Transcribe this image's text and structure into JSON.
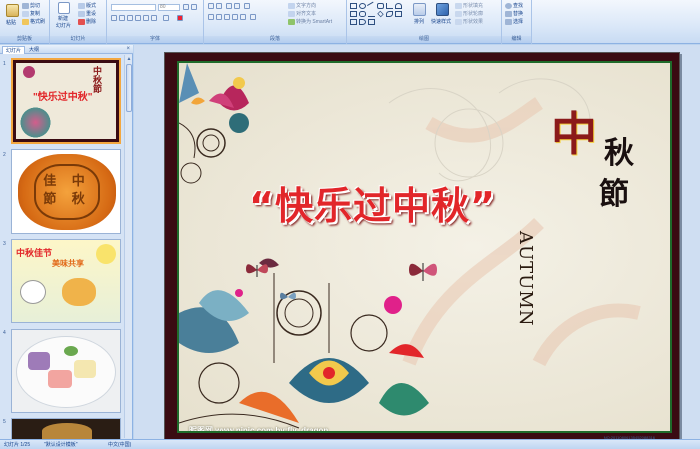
{
  "ribbon": {
    "groups": {
      "clipboard": "剪贴板",
      "slides": "幻灯片",
      "font": "字体",
      "paragraph": "段落",
      "drawing": "绘图",
      "editing": "编辑"
    },
    "clipboard": {
      "paste": "粘贴",
      "cut": "剪切",
      "copy": "复制",
      "format_painter": "格式刷"
    },
    "slides": {
      "new_slide": "新建",
      "new_slide2": "幻灯片",
      "layout": "版式",
      "reset": "重设",
      "delete": "删除"
    },
    "font": {
      "font_name": "",
      "font_size": "80"
    },
    "paragraph": {
      "text_direction": "文字方向",
      "align_text": "对齐文本",
      "smartart": "转换为 SmartArt"
    },
    "drawing": {
      "arrange": "排列",
      "quick_styles": "快速样式",
      "shape_fill": "形状填充",
      "shape_outline": "形状轮廓",
      "shape_effects": "形状效果"
    },
    "editing": {
      "find": "查找",
      "replace": "替换",
      "select": "选择"
    }
  },
  "pane": {
    "tab_slides": "幻灯片",
    "tab_outline": "大纲",
    "close": "×",
    "thumbnails": [
      {
        "num": "1",
        "caption_main": "\"快乐过中秋\"",
        "caption_side": "中秋節",
        "caption_en": "AUTUMN"
      },
      {
        "num": "2",
        "caption_main": "佳 中 節 秋"
      },
      {
        "num": "3",
        "caption_main": "中秋佳节",
        "caption_sub": "美味共享"
      },
      {
        "num": "4"
      },
      {
        "num": "5"
      }
    ]
  },
  "slide": {
    "title": "“快乐过中秋”",
    "zhong": "中",
    "qiu": "秋",
    "jie": "節",
    "autumn": "AUTUMN",
    "watermark": "昵图网 www.nipic.com by:fly_dragon",
    "watermark2": "NO:20110806135452088316"
  },
  "status": {
    "slide_count": "幻灯片 1/25",
    "theme": "\"默认设计模板\"",
    "language": "中文(中国)"
  },
  "colors": {
    "ribbon_bg": "#dbe8f8",
    "title_red": "#e2262a",
    "frame_dark": "#3a0b12",
    "border_green": "#1f6b2a",
    "selection_orange": "#f3a740"
  }
}
